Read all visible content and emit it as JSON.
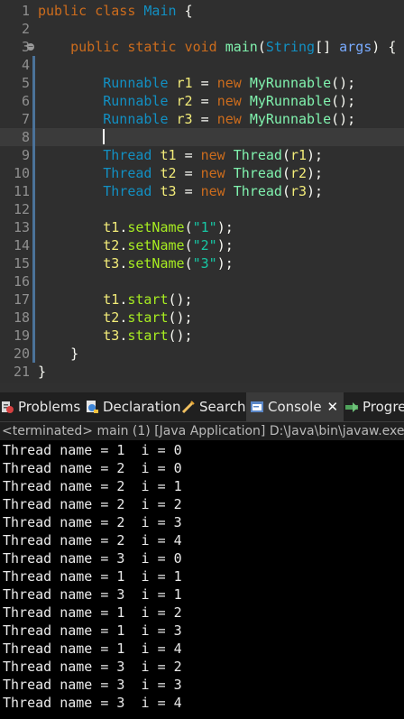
{
  "editor": {
    "lines": [
      {
        "n": "1",
        "parts": [
          [
            "kw",
            "public "
          ],
          [
            "kw",
            "class "
          ],
          [
            "cls",
            "Main "
          ],
          [
            "pun",
            "{"
          ]
        ]
      },
      {
        "n": "2",
        "parts": []
      },
      {
        "n": "3",
        "fold": true,
        "parts": [
          [
            "pun",
            "    "
          ],
          [
            "kw",
            "public "
          ],
          [
            "kw",
            "static "
          ],
          [
            "kw",
            "void "
          ],
          [
            "fn",
            "main"
          ],
          [
            "pun",
            "("
          ],
          [
            "cls",
            "String"
          ],
          [
            "pun",
            "[] "
          ],
          [
            "param",
            "args"
          ],
          [
            "pun",
            ") {"
          ]
        ]
      },
      {
        "n": "4",
        "parts": []
      },
      {
        "n": "5",
        "parts": [
          [
            "pun",
            "        "
          ],
          [
            "cls",
            "Runnable "
          ],
          [
            "var",
            "r1 "
          ],
          [
            "pun",
            "= "
          ],
          [
            "kw",
            "new "
          ],
          [
            "fn",
            "MyRunnable"
          ],
          [
            "pun",
            "();"
          ]
        ]
      },
      {
        "n": "6",
        "parts": [
          [
            "pun",
            "        "
          ],
          [
            "cls",
            "Runnable "
          ],
          [
            "var",
            "r2 "
          ],
          [
            "pun",
            "= "
          ],
          [
            "kw",
            "new "
          ],
          [
            "fn",
            "MyRunnable"
          ],
          [
            "pun",
            "();"
          ]
        ]
      },
      {
        "n": "7",
        "parts": [
          [
            "pun",
            "        "
          ],
          [
            "cls",
            "Runnable "
          ],
          [
            "var",
            "r3 "
          ],
          [
            "pun",
            "= "
          ],
          [
            "kw",
            "new "
          ],
          [
            "fn",
            "MyRunnable"
          ],
          [
            "pun",
            "();"
          ]
        ]
      },
      {
        "n": "8",
        "current": true,
        "parts": [
          [
            "pun",
            "        "
          ]
        ]
      },
      {
        "n": "9",
        "parts": [
          [
            "pun",
            "        "
          ],
          [
            "cls",
            "Thread "
          ],
          [
            "var",
            "t1 "
          ],
          [
            "pun",
            "= "
          ],
          [
            "kw",
            "new "
          ],
          [
            "fn",
            "Thread"
          ],
          [
            "pun",
            "("
          ],
          [
            "var",
            "r1"
          ],
          [
            "pun",
            ");"
          ]
        ]
      },
      {
        "n": "10",
        "parts": [
          [
            "pun",
            "        "
          ],
          [
            "cls",
            "Thread "
          ],
          [
            "var",
            "t2 "
          ],
          [
            "pun",
            "= "
          ],
          [
            "kw",
            "new "
          ],
          [
            "fn",
            "Thread"
          ],
          [
            "pun",
            "("
          ],
          [
            "var",
            "r2"
          ],
          [
            "pun",
            ");"
          ]
        ]
      },
      {
        "n": "11",
        "parts": [
          [
            "pun",
            "        "
          ],
          [
            "cls",
            "Thread "
          ],
          [
            "var",
            "t3 "
          ],
          [
            "pun",
            "= "
          ],
          [
            "kw",
            "new "
          ],
          [
            "fn",
            "Thread"
          ],
          [
            "pun",
            "("
          ],
          [
            "var",
            "r3"
          ],
          [
            "pun",
            ");"
          ]
        ]
      },
      {
        "n": "12",
        "parts": []
      },
      {
        "n": "13",
        "parts": [
          [
            "pun",
            "        "
          ],
          [
            "var",
            "t1"
          ],
          [
            "pun",
            "."
          ],
          [
            "method",
            "setName"
          ],
          [
            "pun",
            "("
          ],
          [
            "str",
            "\"1\""
          ],
          [
            "pun",
            ");"
          ]
        ]
      },
      {
        "n": "14",
        "parts": [
          [
            "pun",
            "        "
          ],
          [
            "var",
            "t2"
          ],
          [
            "pun",
            "."
          ],
          [
            "method",
            "setName"
          ],
          [
            "pun",
            "("
          ],
          [
            "str",
            "\"2\""
          ],
          [
            "pun",
            ");"
          ]
        ]
      },
      {
        "n": "15",
        "parts": [
          [
            "pun",
            "        "
          ],
          [
            "var",
            "t3"
          ],
          [
            "pun",
            "."
          ],
          [
            "method",
            "setName"
          ],
          [
            "pun",
            "("
          ],
          [
            "str",
            "\"3\""
          ],
          [
            "pun",
            ");"
          ]
        ]
      },
      {
        "n": "16",
        "parts": []
      },
      {
        "n": "17",
        "parts": [
          [
            "pun",
            "        "
          ],
          [
            "var",
            "t1"
          ],
          [
            "pun",
            "."
          ],
          [
            "method",
            "start"
          ],
          [
            "pun",
            "();"
          ]
        ]
      },
      {
        "n": "18",
        "parts": [
          [
            "pun",
            "        "
          ],
          [
            "var",
            "t2"
          ],
          [
            "pun",
            "."
          ],
          [
            "method",
            "start"
          ],
          [
            "pun",
            "();"
          ]
        ]
      },
      {
        "n": "19",
        "parts": [
          [
            "pun",
            "        "
          ],
          [
            "var",
            "t3"
          ],
          [
            "pun",
            "."
          ],
          [
            "method",
            "start"
          ],
          [
            "pun",
            "();"
          ]
        ]
      },
      {
        "n": "20",
        "parts": [
          [
            "pun",
            "    }"
          ]
        ]
      },
      {
        "n": "21",
        "parts": [
          [
            "pun",
            "}"
          ]
        ]
      }
    ]
  },
  "views": {
    "tabs": [
      {
        "id": "problems",
        "label": "Problems",
        "icon": "problems-icon"
      },
      {
        "id": "declaration",
        "label": "Declaration",
        "icon": "declaration-icon"
      },
      {
        "id": "search",
        "label": "Search",
        "icon": "search-icon"
      },
      {
        "id": "console",
        "label": "Console",
        "icon": "console-icon",
        "active": true,
        "closable": true
      },
      {
        "id": "progress",
        "label": "Progre",
        "icon": "progress-icon"
      }
    ],
    "close_glyph": "✕"
  },
  "console": {
    "status": "<terminated> main (1) [Java Application] D:\\Java\\bin\\javaw.exe",
    "output": [
      "Thread name = 1  i = 0",
      "Thread name = 2  i = 0",
      "Thread name = 2  i = 1",
      "Thread name = 2  i = 2",
      "Thread name = 2  i = 3",
      "Thread name = 2  i = 4",
      "Thread name = 3  i = 0",
      "Thread name = 1  i = 1",
      "Thread name = 3  i = 1",
      "Thread name = 1  i = 2",
      "Thread name = 1  i = 3",
      "Thread name = 1  i = 4",
      "Thread name = 3  i = 2",
      "Thread name = 3  i = 3",
      "Thread name = 3  i = 4"
    ]
  },
  "colors": {
    "editor_bg": "#2f2f2f",
    "keyword": "#cc6c1d",
    "class": "#1290c3",
    "variable": "#f3ec79",
    "string": "#17c6a3",
    "console_bg": "#000000"
  }
}
